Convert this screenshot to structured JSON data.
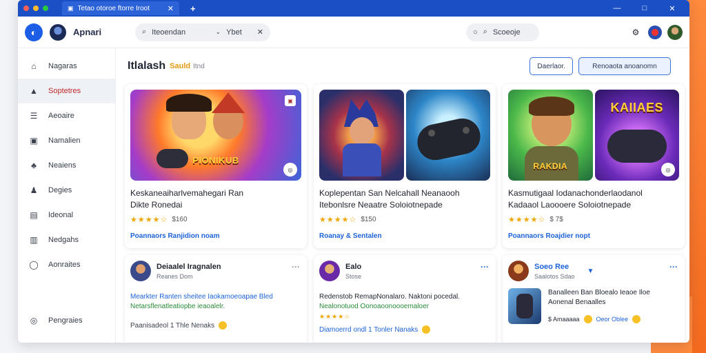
{
  "window": {
    "tab_title": "Tetao otoroe ftorre Iroot",
    "new_tab_icon": "plus-icon",
    "controls": [
      "—",
      "□",
      "✕"
    ]
  },
  "toolbar": {
    "app_name": "Apnari",
    "search_query": "Iteoendan",
    "search_suffix": "Ybet",
    "search2_text": "Scoeoje"
  },
  "sidebar": {
    "items": [
      {
        "label": "Nagaras",
        "icon": "home-icon"
      },
      {
        "label": "Soptetres",
        "icon": "store-icon",
        "active": true
      },
      {
        "label": "Aeoaire",
        "icon": "list-icon"
      },
      {
        "label": "Namalien",
        "icon": "gamepad-icon"
      },
      {
        "label": "Neaiens",
        "icon": "people-icon"
      },
      {
        "label": "Degies",
        "icon": "person-icon"
      },
      {
        "label": "Ideonal",
        "icon": "document-icon"
      },
      {
        "label": "Nedgahs",
        "icon": "book-icon"
      },
      {
        "label": "Aonraites",
        "icon": "chat-icon"
      }
    ],
    "bottom_label": "Pengraies"
  },
  "main": {
    "title": "Itlalash",
    "subtitle": "Sauld",
    "subtitle2": "Itnd",
    "btn_secondary": "Daerlaor.",
    "btn_primary": "Renoaota anoanomn"
  },
  "cards": [
    {
      "art_text": "PIONIKUB",
      "title_line1": "Keskaneaiharlvemahegari Ran",
      "title_line2": "Dikte Ronedai",
      "stars": "★★★★☆",
      "rating": "$160",
      "link": "Poannaors Ranjidion noam"
    },
    {
      "art_text": "",
      "title_line1": "Koplepentan San Nelcahall Neanaooh",
      "title_line2": "Itebonlsre Neaatre Soloiotnepade",
      "stars": "★★★★☆",
      "rating": "$150",
      "link": "Roanay & Sentalen"
    },
    {
      "art_text": "KAIIAES",
      "art_text2": "RAKDIA",
      "title_line1": "Kasmutigaal Iodanachonderlaodanol",
      "title_line2": "Kadaaol Laoooere Soloiotnepade",
      "stars": "★★★★☆",
      "rating": "$ 7$",
      "link": "Poannaors Roajdier nopt"
    }
  ],
  "posts": [
    {
      "name": "Deiaalel Iragnalen",
      "meta": "Reanes Dom",
      "line1": "Mearkter Ranten sheitee Iaokamoeoapae Bled",
      "line2": "Netarsflenatleatiopbe ieaoalelr.",
      "foot": "Paanisadeol 1 Thle Nenaks"
    },
    {
      "name": "Ealo",
      "meta": "Stose",
      "line1": "Redenstob RemapNonalaro. Naktoni pocedal.",
      "line2": "Nealonotuod Oonoaoonoooemaloer",
      "stars": "★★★★☆",
      "foot": "Diamoerrd ondl 1 Tonler Nanaks"
    },
    {
      "name": "Soeo Ree",
      "meta": "Saalotos Sdao",
      "line1": "Banalleen Ban Bloealo Ieaoe Iloe",
      "line2": "Aonenal Benaalles",
      "foot1": "$ Amaaaaa",
      "foot2": "Oeor Oblee"
    }
  ]
}
